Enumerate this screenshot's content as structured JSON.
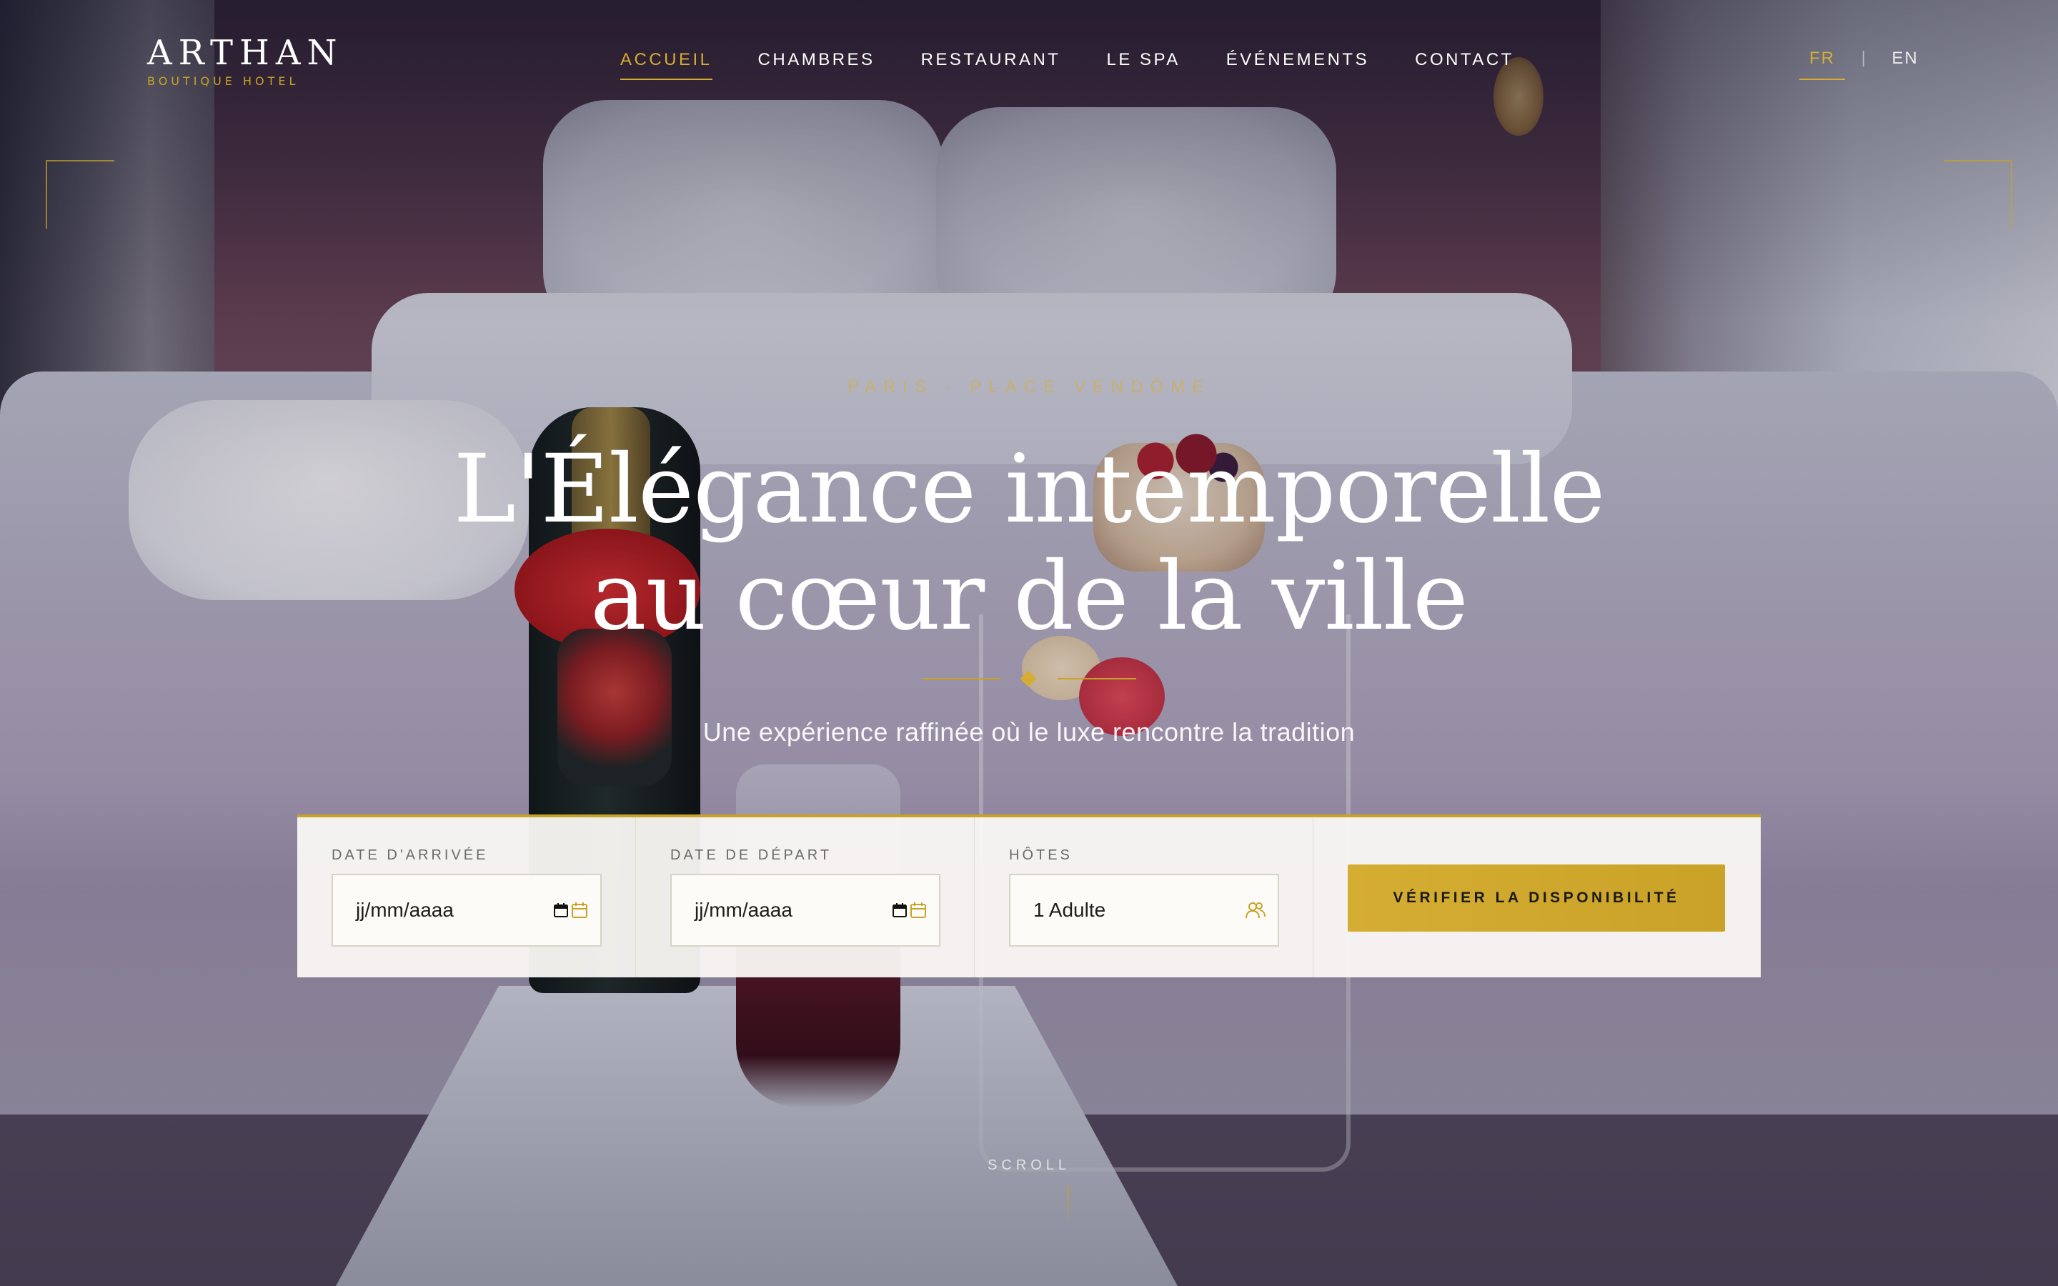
{
  "brand": {
    "name": "ARTHAN",
    "tagline": "BOUTIQUE HOTEL",
    "accent_color": "#c9a227"
  },
  "nav": {
    "items": [
      {
        "label": "ACCUEIL",
        "active": true
      },
      {
        "label": "CHAMBRES",
        "active": false
      },
      {
        "label": "RESTAURANT",
        "active": false
      },
      {
        "label": "LE SPA",
        "active": false
      },
      {
        "label": "ÉVÉNEMENTS",
        "active": false
      },
      {
        "label": "CONTACT",
        "active": false
      }
    ]
  },
  "language": {
    "options": [
      "FR",
      "EN"
    ],
    "separator": "|",
    "active": "FR"
  },
  "hero": {
    "eyebrow": "PARIS · PLACE VENDÔME",
    "title_line1": "L'Élégance intemporelle",
    "title_line2": "au cœur de la ville",
    "subtitle": "Une expérience raffinée où le luxe rencontre la tradition"
  },
  "booking": {
    "arrival": {
      "label": "DATE D'ARRIVÉE",
      "placeholder": "jj/mm/aaaa",
      "icon": "calendar-icon"
    },
    "departure": {
      "label": "DATE DE DÉPART",
      "placeholder": "jj/mm/aaaa",
      "icon": "calendar-icon"
    },
    "guests": {
      "label": "HÔTES",
      "value": "1 Adulte",
      "icon": "users-icon"
    },
    "submit_label": "VÉRIFIER LA DISPONIBILITÉ"
  },
  "scroll": {
    "label": "SCROLL"
  }
}
